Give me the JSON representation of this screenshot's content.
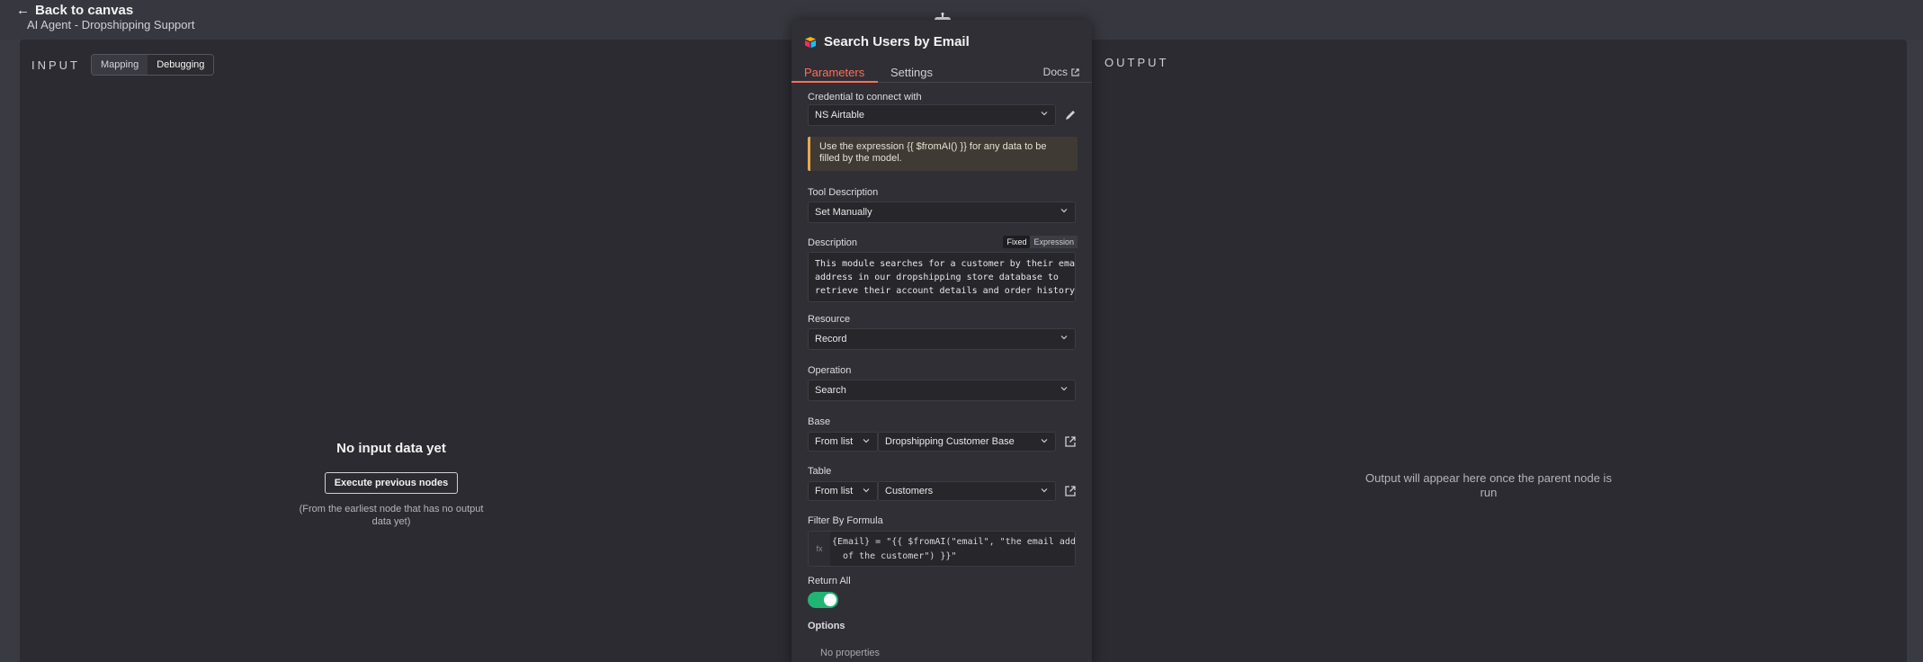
{
  "topbar": {
    "back_label": "Back to canvas",
    "workflow_name": "AI Agent - Dropshipping Support"
  },
  "input_panel": {
    "title": "INPUT",
    "modes": [
      "Mapping",
      "Debugging"
    ],
    "active_mode": "Debugging",
    "empty_title": "No input data yet",
    "execute_button": "Execute previous nodes",
    "empty_hint": "(From the earliest node that has no output data yet)"
  },
  "output_panel": {
    "title": "OUTPUT",
    "message": "Output will appear here once the parent node is run"
  },
  "node": {
    "title": "Search Users by Email",
    "tabs": [
      "Parameters",
      "Settings"
    ],
    "active_tab": "Parameters",
    "docs_label": "Docs",
    "credential": {
      "label": "Credential to connect with",
      "value": "NS Airtable"
    },
    "notice": "Use the expression {{ $fromAI() }} for any data to be filled by the model.",
    "tool_description": {
      "label": "Tool Description",
      "value": "Set Manually"
    },
    "description": {
      "label": "Description",
      "fixed_label": "Fixed",
      "expression_label": "Expression",
      "value": "This module searches for a customer by their email\naddress in our dropshipping store database to\nretrieve their account details and order history."
    },
    "resource": {
      "label": "Resource",
      "value": "Record"
    },
    "operation": {
      "label": "Operation",
      "value": "Search"
    },
    "base": {
      "label": "Base",
      "mode": "From list",
      "value": "Dropshipping Customer Base"
    },
    "table": {
      "label": "Table",
      "mode": "From list",
      "value": "Customers"
    },
    "filter": {
      "label": "Filter By Formula",
      "fx": "fx",
      "value": "{Email} = \"{{ $fromAI(\"email\", \"the email address\n  of the customer\") }}\""
    },
    "return_all": {
      "label": "Return All",
      "enabled": true
    },
    "options": {
      "label": "Options",
      "empty": "No properties"
    }
  },
  "colors": {
    "accent": "#ff6d5a",
    "toggle_on": "#20b573",
    "warning_border": "#e8a84a"
  }
}
